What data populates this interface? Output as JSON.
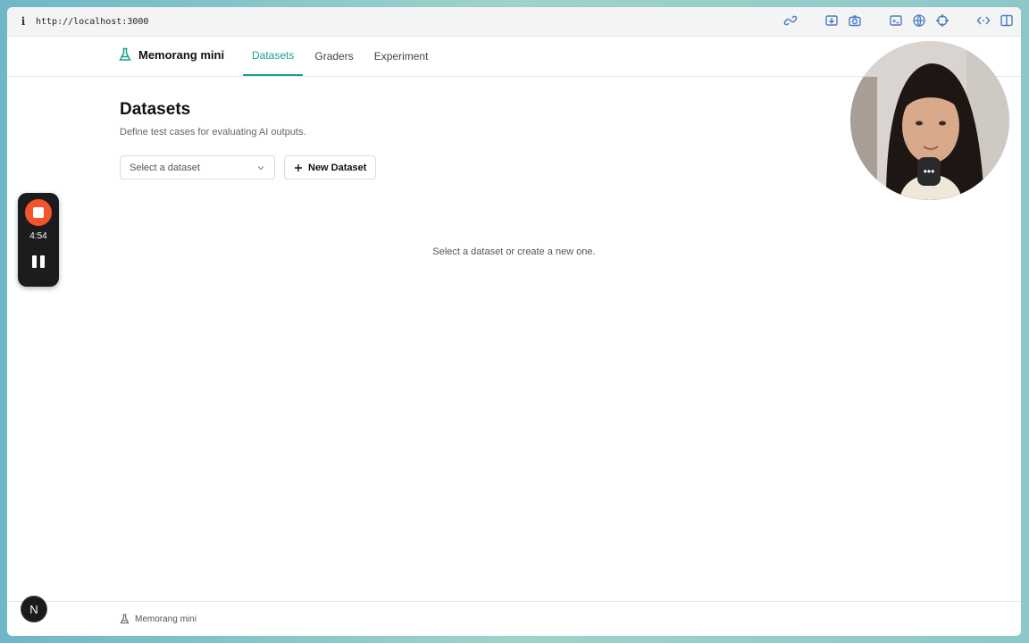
{
  "browser": {
    "url": "http://localhost:3000",
    "icons": [
      "link-icon",
      "download-icon",
      "camera-icon",
      "terminal-icon",
      "globe-icon",
      "crosshair-icon",
      "code-icon",
      "sidebar-icon"
    ]
  },
  "app": {
    "brand": "Memorang mini",
    "tabs": [
      {
        "label": "Datasets",
        "active": true
      },
      {
        "label": "Graders",
        "active": false
      },
      {
        "label": "Experiment",
        "active": false
      }
    ],
    "accent": "#1a9e8f"
  },
  "page": {
    "title": "Datasets",
    "subtitle": "Define test cases for evaluating AI outputs.",
    "select_placeholder": "Select a dataset",
    "new_button": "New Dataset",
    "empty_message": "Select a dataset or create a new one."
  },
  "footer": {
    "brand": "Memorang mini"
  },
  "recorder": {
    "time": "4:54",
    "stop_color": "#f4542c"
  },
  "next_badge": "N"
}
